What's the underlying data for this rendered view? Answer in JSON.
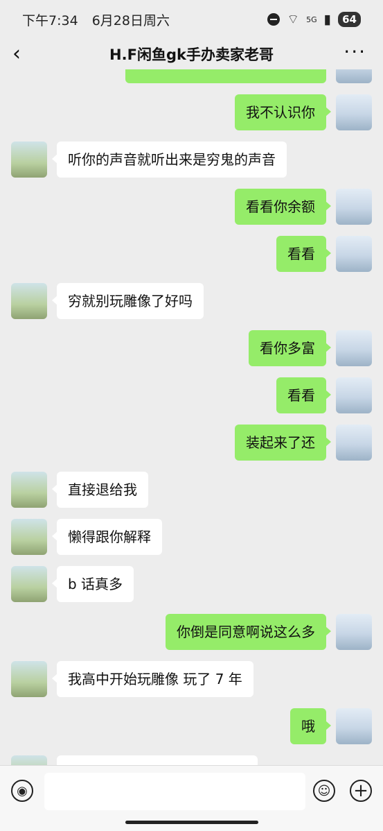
{
  "status": {
    "time": "下午7:34",
    "date": "6月28日周六",
    "network": "5G",
    "battery": "64"
  },
  "header": {
    "title": "H.F闲鱼gk手办卖家老哥",
    "back_icon": "back-arrow-icon",
    "more_label": "···"
  },
  "messages": [
    {
      "side": "self",
      "text": ""
    },
    {
      "side": "self",
      "text": "我不认识你"
    },
    {
      "side": "other",
      "text": "听你的声音就听出来是穷鬼的声音"
    },
    {
      "side": "self",
      "text": "看看你余额"
    },
    {
      "side": "self",
      "text": "看看"
    },
    {
      "side": "other",
      "text": "穷就别玩雕像了好吗"
    },
    {
      "side": "self",
      "text": "看你多富"
    },
    {
      "side": "self",
      "text": "看看"
    },
    {
      "side": "self",
      "text": "装起来了还"
    },
    {
      "side": "other",
      "text": "直接退给我"
    },
    {
      "side": "other",
      "text": "懒得跟你解释"
    },
    {
      "side": "other",
      "text": "b 话真多"
    },
    {
      "side": "self",
      "text": "你倒是同意啊说这么多"
    },
    {
      "side": "other",
      "text": "我高中开始玩雕像 玩了 7 年"
    },
    {
      "side": "self",
      "text": "哦"
    },
    {
      "side": "other",
      "text": ""
    }
  ],
  "input": {
    "placeholder": ""
  },
  "colors": {
    "self_bubble": "#95ec69",
    "other_bubble": "#ffffff",
    "background": "#ededed"
  }
}
